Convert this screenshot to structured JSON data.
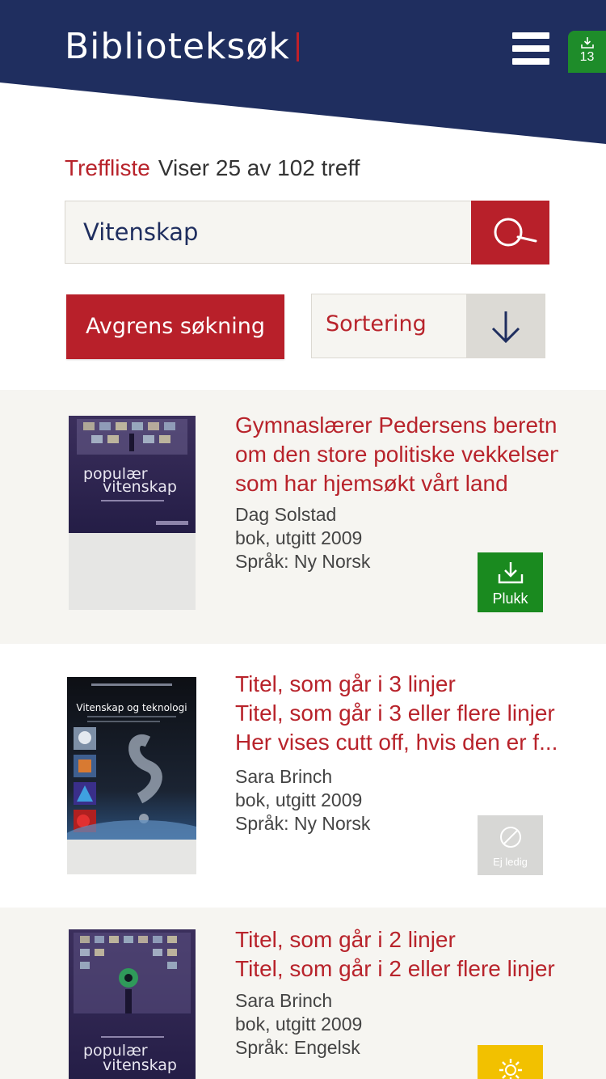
{
  "header": {
    "app_title": "Biblioteksøk",
    "download_count": "13"
  },
  "results_summary": {
    "label": "Treffliste",
    "count_text": "Viser 25 av 102 treff"
  },
  "search": {
    "value": "Vitenskap"
  },
  "filters": {
    "refine_label": "Avgrens søkning",
    "sort_label": "Sortering"
  },
  "results": [
    {
      "title_lines": [
        "Gymnaslærer Pedersens beretning",
        "om den store politiske vekkelsen",
        "som har hjemsøkt vårt land"
      ],
      "author": "Dag Solstad",
      "format": "bok, utgitt 2009",
      "language": "Språk: Ny Norsk",
      "cover_text": [
        "populær",
        "vitenskap"
      ],
      "action": {
        "label": "Plukk",
        "status": "available",
        "color": "#1a8a1f",
        "icon": "download-icon"
      }
    },
    {
      "title_lines": [
        "Titel, som går i 3 linjer",
        "Titel, som går i 3 eller flere linjer",
        "Her vises cutt off, hvis den er f..."
      ],
      "author": "Sara Brinch",
      "format": "bok, utgitt 2009",
      "language": "Språk: Ny Norsk",
      "cover_text": [
        "Vitenskap og teknologi"
      ],
      "action": {
        "label": "Ej ledig",
        "status": "unavailable",
        "color": "#d7d7d5",
        "icon": "unavailable-icon"
      }
    },
    {
      "title_lines": [
        "Titel, som går i 2 linjer",
        "Titel, som går i 2 eller flere linjer"
      ],
      "author": "Sara Brinch",
      "format": "bok, utgitt 2009",
      "language": "Språk: Engelsk",
      "cover_text": [
        "populær",
        "vitenskap"
      ],
      "action": {
        "label": "",
        "status": "settings",
        "color": "#f2c100",
        "icon": "gear-icon"
      }
    }
  ],
  "colors": {
    "header_navy": "#1f2e5f",
    "accent_red": "#b8202a",
    "background_shade": "#f6f5f1"
  }
}
